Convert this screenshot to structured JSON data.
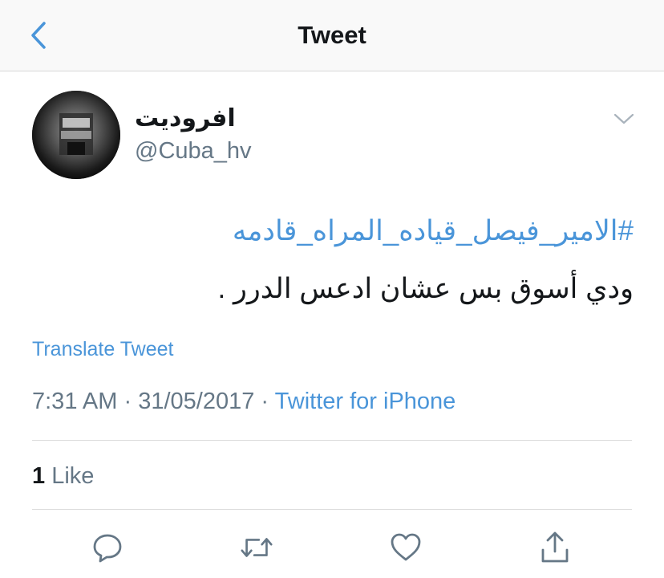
{
  "nav": {
    "title": "Tweet",
    "back_icon": "chevron-left-icon"
  },
  "tweet": {
    "author": {
      "display_name": "افروديت",
      "handle": "@Cuba_hv"
    },
    "hashtag": "#الامير_فيصل_قياده_المراه_قادمه",
    "text": "ودي أسوق بس عشان ادعس الدرر .",
    "translate_label": "Translate Tweet",
    "time": "7:31 AM",
    "separator": "·",
    "date": "31/05/2017",
    "source": "Twitter for iPhone",
    "like_count": "1",
    "like_label": "Like"
  },
  "actions": [
    "reply-icon",
    "retweet-icon",
    "like-icon",
    "share-icon"
  ],
  "colors": {
    "accent": "#4a95d9",
    "text": "#14171a",
    "secondary": "#657786",
    "icon": "#657786"
  }
}
